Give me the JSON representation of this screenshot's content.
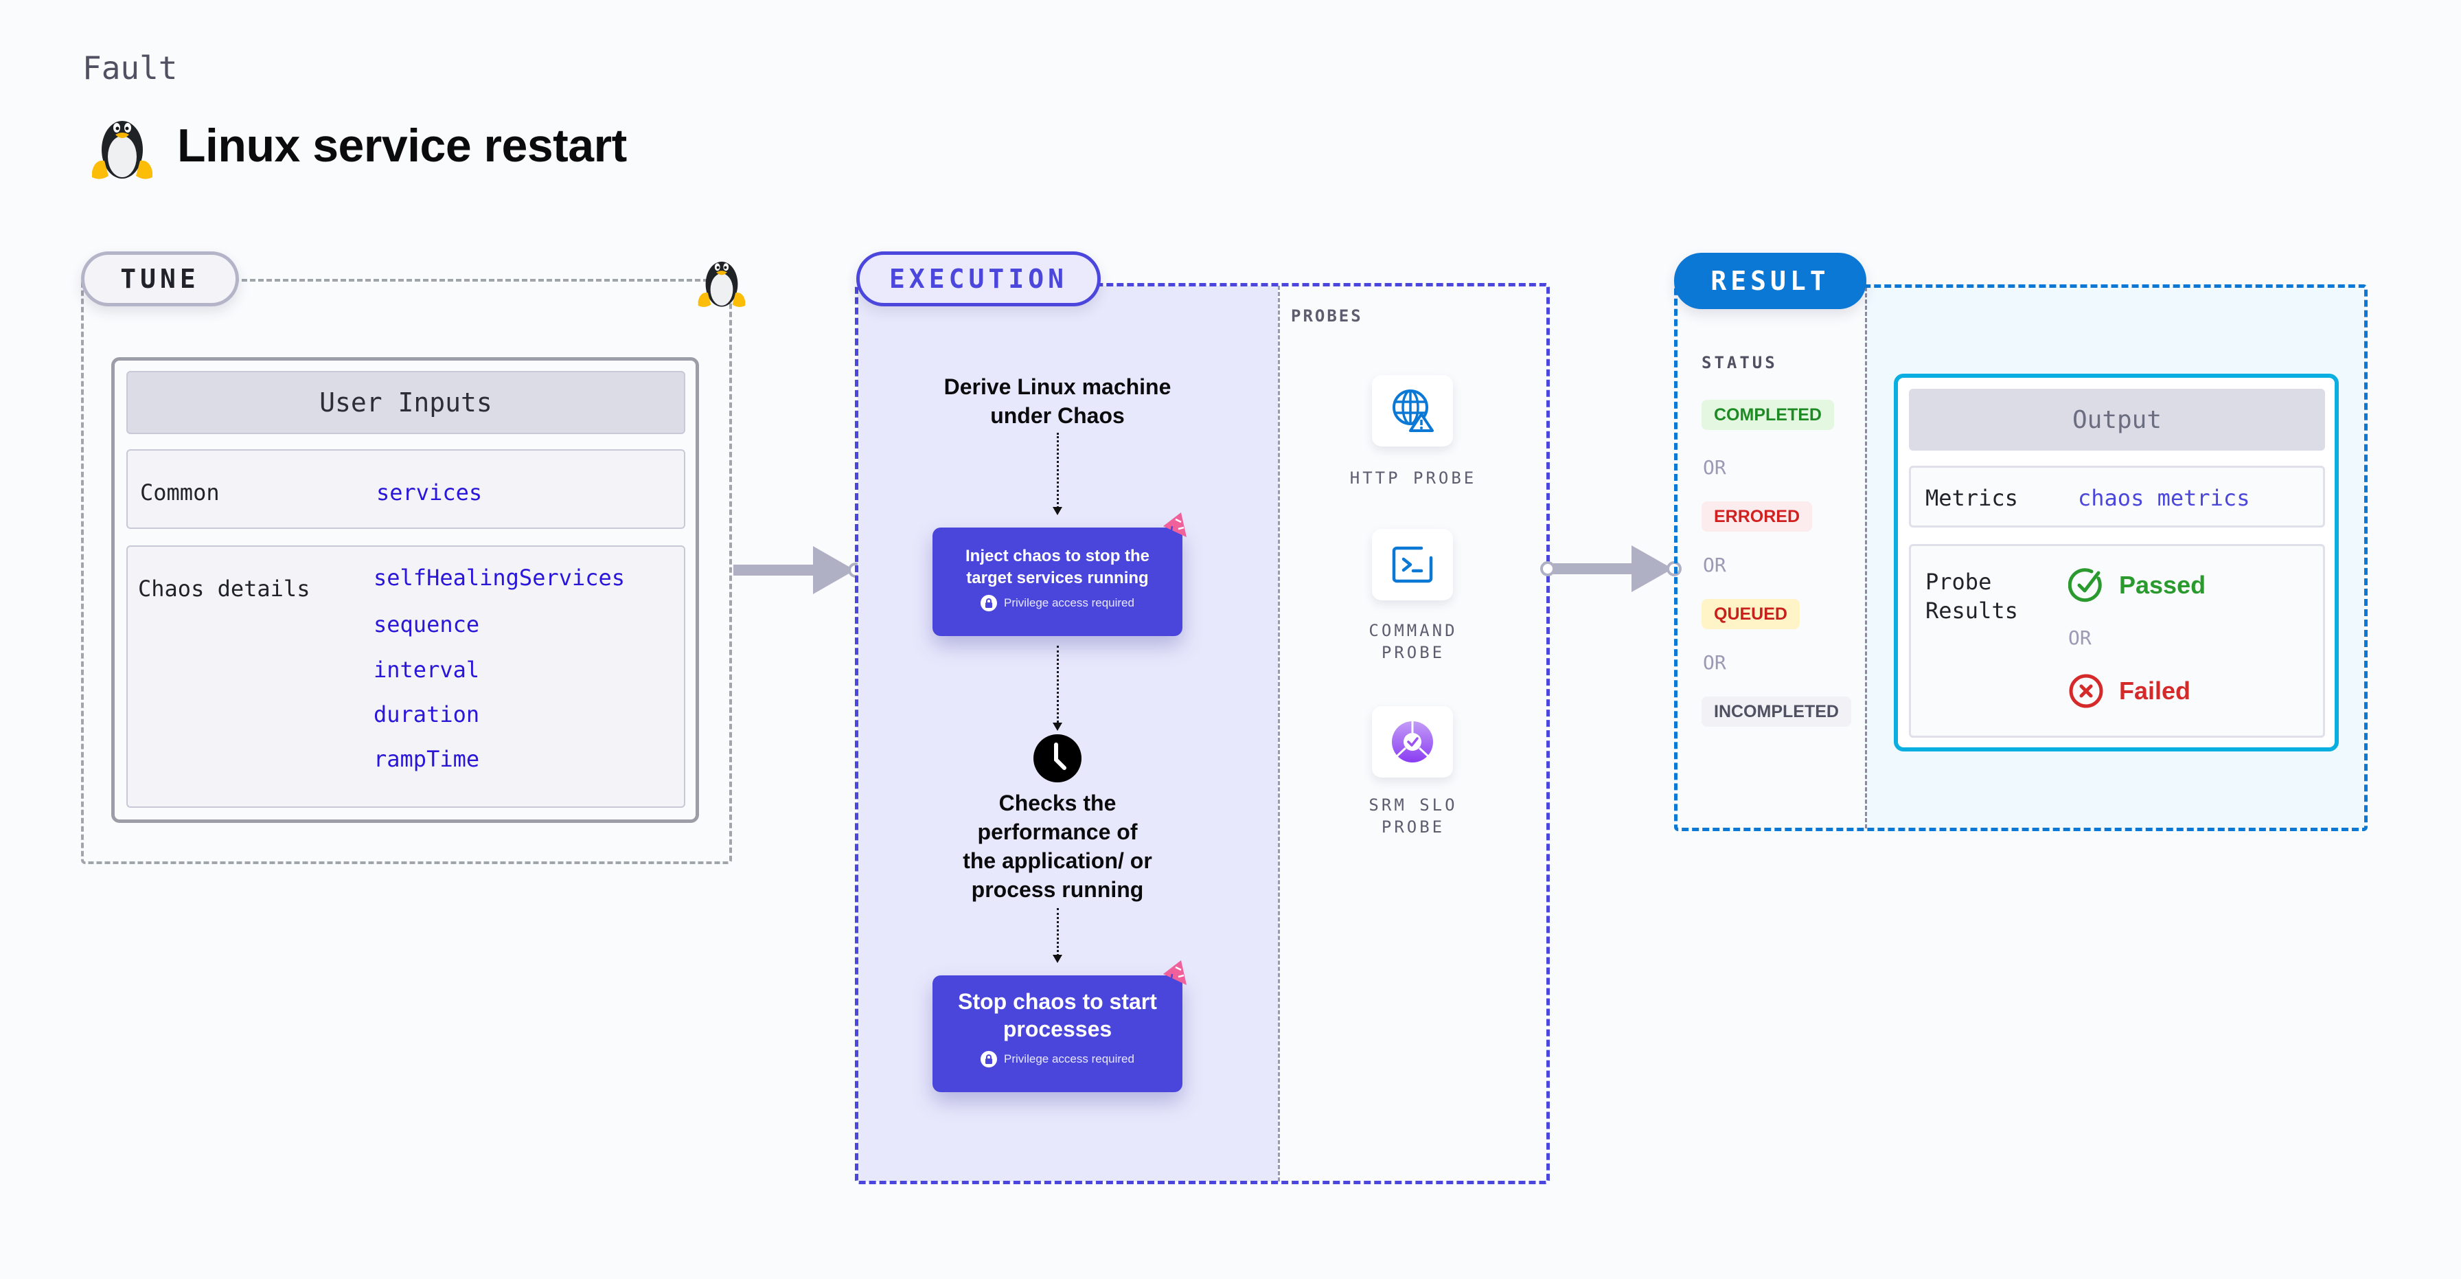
{
  "header": {
    "category": "Fault",
    "title": "Linux service restart",
    "title_icon": "linux-tux-icon"
  },
  "tune": {
    "pill_label": "TUNE",
    "corner_icon": "linux-tux-icon",
    "user_inputs": {
      "heading": "User Inputs",
      "rows": [
        {
          "label": "Common",
          "values": [
            "services"
          ]
        },
        {
          "label": "Chaos details",
          "values": [
            "selfHealingServices",
            "sequence",
            "interval",
            "duration",
            "rampTime"
          ]
        }
      ]
    }
  },
  "execution": {
    "pill_label": "EXECUTION",
    "steps": [
      {
        "type": "text",
        "text": "Derive Linux machine under Chaos",
        "lines": [
          "Derive Linux machine",
          "under Chaos"
        ]
      },
      {
        "type": "card",
        "lines": [
          "Inject chaos to stop the",
          "target services running"
        ],
        "note": "Privilege access required",
        "badge_icon": "chaos-tag-icon"
      },
      {
        "type": "wait",
        "icon": "clock-icon",
        "lines": [
          "Checks the",
          "performance of",
          "the application/ or",
          "process running"
        ]
      },
      {
        "type": "card",
        "lines": [
          "Stop chaos to start",
          "processes"
        ],
        "note": "Privilege access required",
        "badge_icon": "chaos-tag-icon"
      }
    ],
    "probes": {
      "title": "PROBES",
      "items": [
        {
          "icon": "globe-warning-icon",
          "lines": [
            "HTTP PROBE"
          ]
        },
        {
          "icon": "terminal-icon",
          "lines": [
            "COMMAND",
            "PROBE"
          ]
        },
        {
          "icon": "srm-slo-icon",
          "lines": [
            "SRM SLO",
            "PROBE"
          ]
        }
      ]
    }
  },
  "result": {
    "pill_label": "RESULT",
    "status": {
      "title": "STATUS",
      "separator": "OR",
      "items": [
        {
          "label": "COMPLETED",
          "color": "#1e8a23",
          "bg": "#e4f7e1"
        },
        {
          "label": "ERRORED",
          "color": "#d12020",
          "bg": "#fdeced"
        },
        {
          "label": "QUEUED",
          "color": "#c8211c",
          "bg": "#fff4c8"
        },
        {
          "label": "INCOMPLETED",
          "color": "#4f5162",
          "bg": "#f1f1f6"
        }
      ]
    },
    "output": {
      "heading": "Output",
      "metrics_label": "Metrics",
      "metrics_value": "chaos metrics",
      "probe_results_label": "Probe Results",
      "probe_results_lines": [
        "Probe",
        "Results"
      ],
      "passed": "Passed",
      "or": "OR",
      "failed": "Failed"
    }
  },
  "colors": {
    "execution_accent": "#4b46dc",
    "result_accent": "#0a78d4",
    "output_border": "#0aaee0",
    "param_value": "#2a16d8",
    "passed": "#2a9a2e",
    "failed": "#d52a2a",
    "arrow": "#b0b0c4"
  }
}
